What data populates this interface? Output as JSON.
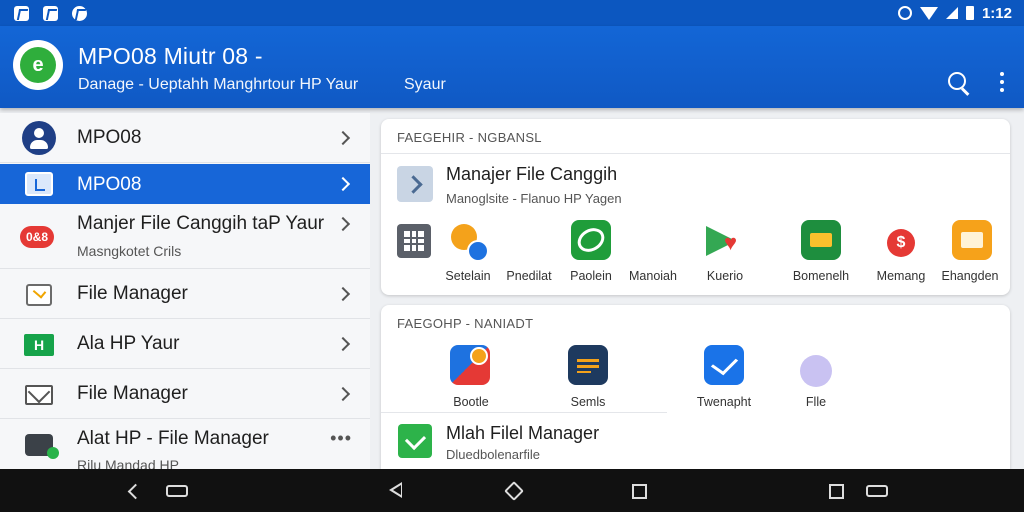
{
  "status_bar": {
    "time": "1:12"
  },
  "app_bar": {
    "title": "MPO08 Miutr 08 -",
    "subtitle": "Danage - Ueptahh Manghrtour HP Yaur",
    "subtitle2": "Syaur"
  },
  "sidebar": {
    "items": [
      {
        "label": "MPO08"
      },
      {
        "label": "MPO08"
      },
      {
        "label": "Manjer File Canggih taP Yaur",
        "sub": "Masngkotet Crils",
        "badge": "0&8"
      },
      {
        "label": "File Manager"
      },
      {
        "label": "Ala HP Yaur",
        "badge": "H"
      },
      {
        "label": "File Manager"
      },
      {
        "label": "Alat HP - File Manager",
        "sub": "Rilu Mandad HP"
      }
    ]
  },
  "card1": {
    "header": "FAEGEHIR - NGBANSL",
    "feature_title": "Manajer File Canggih",
    "feature_sub": "Manoglsite - Flanuo HP Yagen",
    "apps": [
      "Setelain",
      "Pnedilat",
      "Paolein",
      "Manoiah",
      "Kuerio",
      "Bomenelh",
      "Memang",
      "Ehangden"
    ]
  },
  "card2": {
    "header": "FAEGOHP - NANIADT",
    "apps": [
      "Bootle",
      "Semls",
      "Twenapht",
      "Flle"
    ],
    "feature_title": "Mlah Filel Manager",
    "feature_sub": "Dluedbolenarfile"
  }
}
